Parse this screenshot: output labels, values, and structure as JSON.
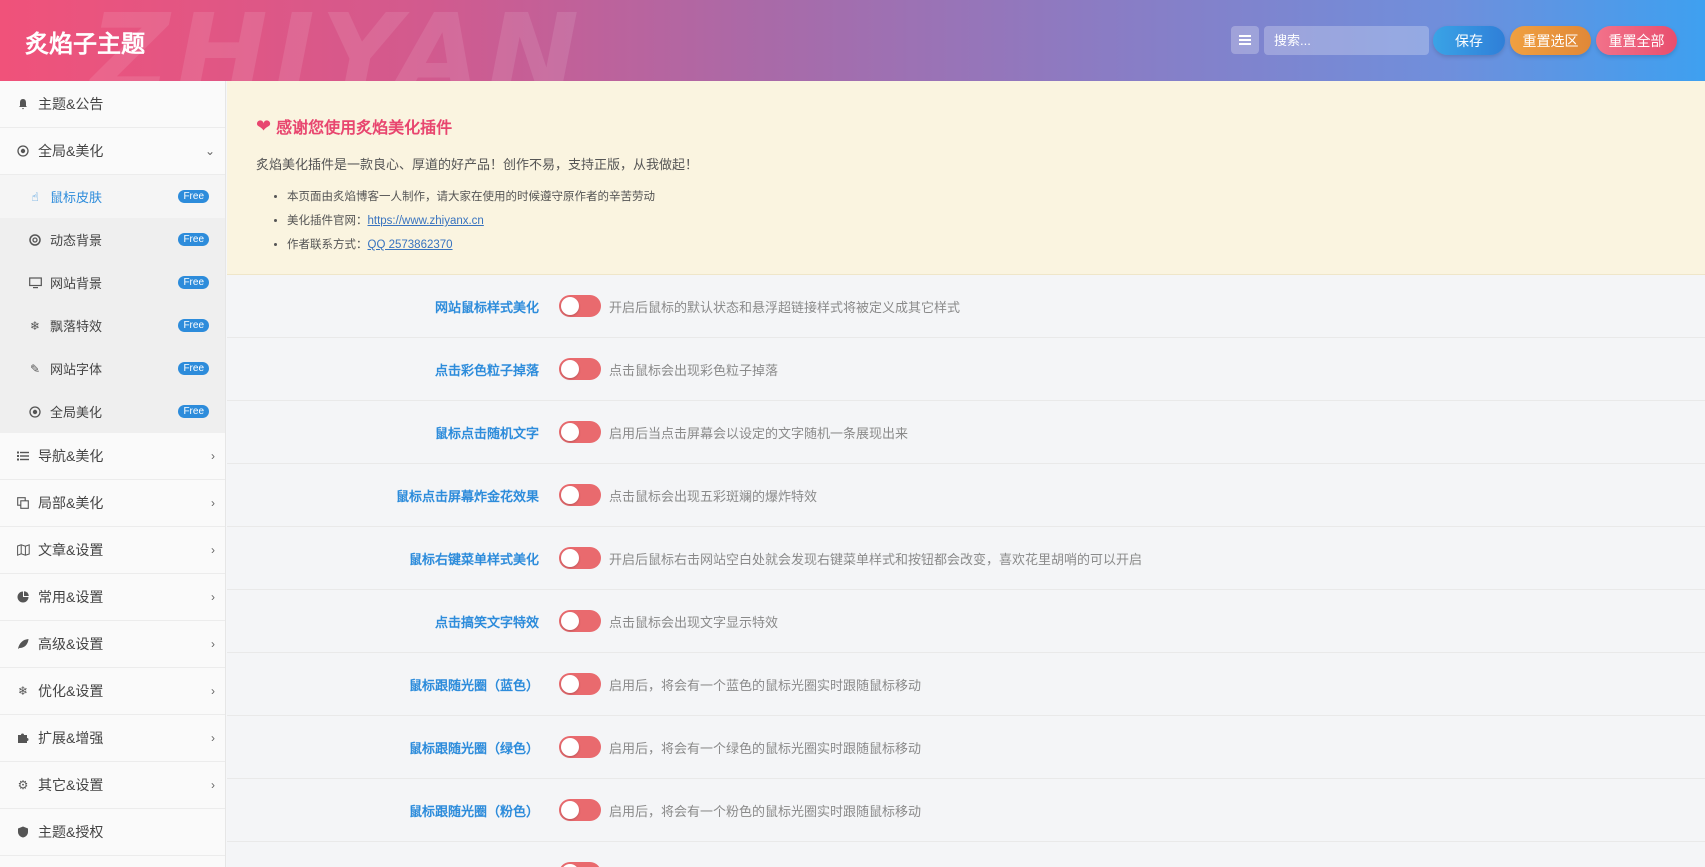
{
  "header": {
    "brand": "炙焰子主题",
    "watermark": "ZHIYAN",
    "search_placeholder": "搜索...",
    "save_label": "保存",
    "reset_section_label": "重置选区",
    "reset_all_label": "重置全部"
  },
  "sidebar": {
    "items": [
      {
        "label": "主题&公告",
        "icon": "bell-icon"
      },
      {
        "label": "全局&美化",
        "icon": "target-icon",
        "expanded": true
      },
      {
        "label": "导航&美化",
        "icon": "list-icon"
      },
      {
        "label": "局部&美化",
        "icon": "copy-icon"
      },
      {
        "label": "文章&设置",
        "icon": "map-icon"
      },
      {
        "label": "常用&设置",
        "icon": "pie-chart-icon"
      },
      {
        "label": "高级&设置",
        "icon": "leaf-icon"
      },
      {
        "label": "优化&设置",
        "icon": "snowflake-icon"
      },
      {
        "label": "扩展&增强",
        "icon": "puzzle-icon"
      },
      {
        "label": "其它&设置",
        "icon": "gear-icon"
      },
      {
        "label": "主题&授权",
        "icon": "shield-icon"
      }
    ],
    "sub_items": [
      {
        "label": "鼠标皮肤",
        "icon": "pointer-icon",
        "badge": "Free",
        "active": true
      },
      {
        "label": "动态背景",
        "icon": "lifebuoy-icon",
        "badge": "Free"
      },
      {
        "label": "网站背景",
        "icon": "monitor-icon",
        "badge": "Free"
      },
      {
        "label": "飘落特效",
        "icon": "snowflake-icon",
        "badge": "Free"
      },
      {
        "label": "网站字体",
        "icon": "pencil-icon",
        "badge": "Free"
      },
      {
        "label": "全局美化",
        "icon": "target-icon",
        "badge": "Free"
      }
    ]
  },
  "notice": {
    "title": "感谢您使用炙焰美化插件",
    "desc": "炙焰美化插件是一款良心、厚道的好产品！创作不易，支持正版，从我做起！",
    "line1": "本页面由炙焰博客一人制作，请大家在使用的时候遵守原作者的辛苦劳动",
    "line2_prefix": "美化插件官网：",
    "line2_link": "https://www.zhiyanx.cn",
    "line3_prefix": "作者联系方式：",
    "line3_link": "QQ 2573862370"
  },
  "settings": [
    {
      "label": "网站鼠标样式美化",
      "desc": "开启后鼠标的默认状态和悬浮超链接样式将被定义成其它样式",
      "on": true
    },
    {
      "label": "点击彩色粒子掉落",
      "desc": "点击鼠标会出现彩色粒子掉落",
      "on": true
    },
    {
      "label": "鼠标点击随机文字",
      "desc": "启用后当点击屏幕会以设定的文字随机一条展现出来",
      "on": true
    },
    {
      "label": "鼠标点击屏幕炸金花效果",
      "desc": "点击鼠标会出现五彩斑斓的爆炸特效",
      "on": true
    },
    {
      "label": "鼠标右键菜单样式美化",
      "desc": "开启后鼠标右击网站空白处就会发现右键菜单样式和按钮都会改变，喜欢花里胡哨的可以开启",
      "on": true
    },
    {
      "label": "点击搞笑文字特效",
      "desc": "点击鼠标会出现文字显示特效",
      "on": true
    },
    {
      "label": "鼠标跟随光圈（蓝色）",
      "desc": "启用后，将会有一个蓝色的鼠标光圈实时跟随鼠标移动",
      "on": true
    },
    {
      "label": "鼠标跟随光圈（绿色）",
      "desc": "启用后，将会有一个绿色的鼠标光圈实时跟随鼠标移动",
      "on": true
    },
    {
      "label": "鼠标跟随光圈（粉色）",
      "desc": "启用后，将会有一个粉色的鼠标光圈实时跟随鼠标移动",
      "on": true
    }
  ],
  "colors": {
    "accent_blue": "#2d8cdb",
    "toggle_red": "#e96a6e",
    "notice_pink": "#e8466f"
  }
}
